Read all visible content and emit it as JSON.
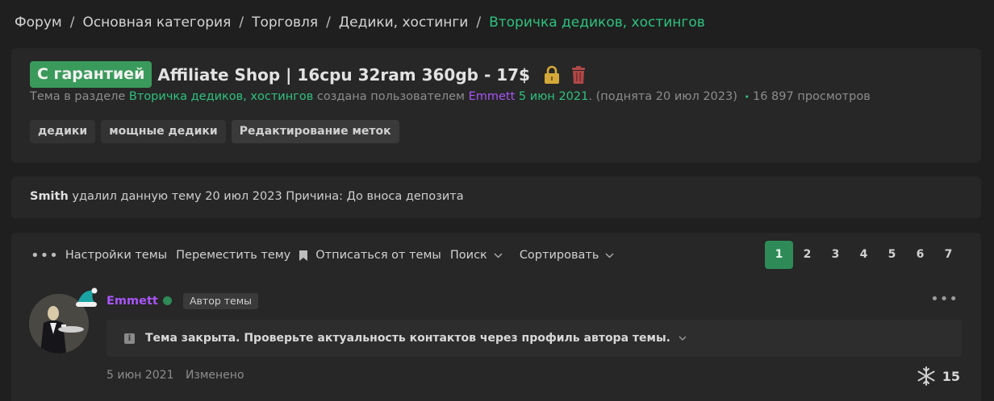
{
  "breadcrumb": {
    "items": [
      "Форум",
      "Основная категория",
      "Торговля",
      "Дедики, хостинги",
      "Вторичка дедиков, хостингов"
    ],
    "separator": "/"
  },
  "thread": {
    "prefix": "С гарантией",
    "title": "Affiliate Shop | 16cpu 32ram 360gb - 17$",
    "meta": {
      "prefix_text": "Тема в разделе",
      "section": "Вторичка дедиков, хостингов",
      "created_by": "создана пользователем",
      "author": "Emmett",
      "date": "5 июн 2021",
      "bumped": ". (поднята 20 июл 2023)",
      "views": "16 897 просмотров"
    },
    "tags": [
      "дедики",
      "мощные дедики"
    ],
    "edit_tags_label": "Редактирование меток",
    "lock_icon": "lock-icon",
    "trash_icon": "trash-icon"
  },
  "deleted_notice": {
    "user": "Smith",
    "text": "удалил данную тему 20 июл 2023 Причина: До вноса депозита"
  },
  "toolbar": {
    "settings": "Настройки темы",
    "move": "Переместить тему",
    "unsubscribe": "Отписаться от темы",
    "search": "Поиск",
    "sort": "Сортировать"
  },
  "pagination": {
    "pages": [
      "1",
      "2",
      "3",
      "4",
      "5",
      "6",
      "7"
    ],
    "current": "1"
  },
  "post": {
    "username": "Emmett",
    "author_badge": "Автор темы",
    "notice": "Тема закрыта. Проверьте актуальность контактов через профиль автора темы.",
    "date": "5 июн 2021",
    "edited": "Изменено",
    "reaction_count": "15",
    "reaction_icon": "snowflake-icon"
  },
  "colors": {
    "accent_green": "#2ec27e",
    "username_purple": "#a855f7",
    "prefix_green": "#3a9a5b",
    "background": "#1f1f1f",
    "panel": "#272727"
  }
}
